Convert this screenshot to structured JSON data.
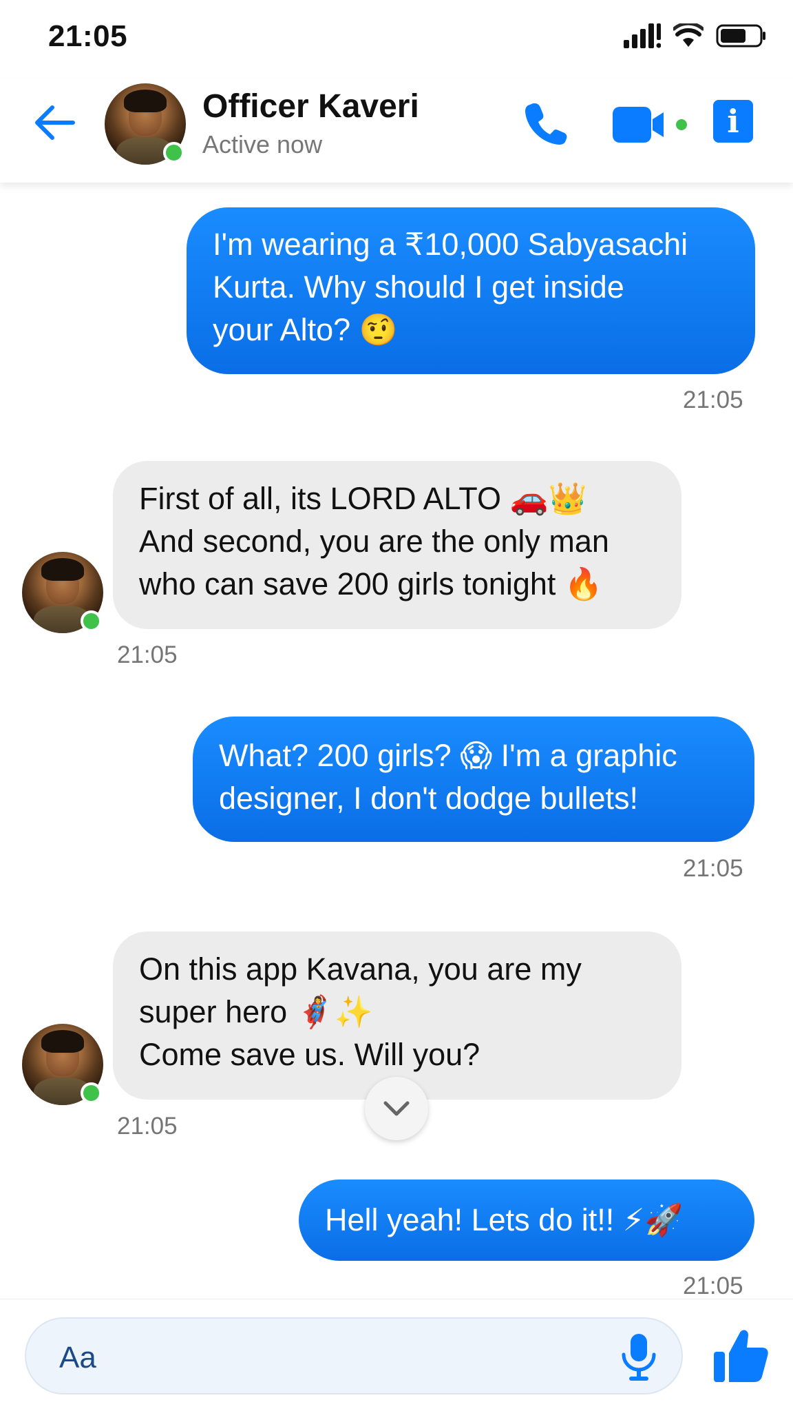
{
  "status_bar": {
    "time": "21:05",
    "icons": [
      "signal-icon",
      "wifi-icon",
      "battery-icon"
    ]
  },
  "header": {
    "name": "Officer Kaveri",
    "status": "Active now",
    "actions": [
      "back-arrow-icon",
      "phone-call-icon",
      "video-call-icon",
      "info-icon"
    ],
    "accent_color": "#0a7cff",
    "online_color": "#3fc24a"
  },
  "messages": [
    {
      "direction": "outgoing",
      "lines": [
        "I'm wearing a ₹10,000 Sabyasachi",
        "Kurta. Why should I get inside",
        "your Alto? 🤨"
      ],
      "time": "21:05"
    },
    {
      "direction": "incoming",
      "lines": [
        "First of all, its LORD ALTO 🚗👑",
        "And second, you are the only man",
        "who can save 200 girls tonight 🔥"
      ],
      "time": "21:05"
    },
    {
      "direction": "outgoing",
      "lines": [
        "What? 200 girls? 😱 I'm a graphic",
        "designer, I don't dodge bullets!"
      ],
      "time": "21:05"
    },
    {
      "direction": "incoming",
      "lines": [
        "On this app Kavana, you are my",
        "super hero 🦸‍♀️✨",
        "Come save us. Will you?"
      ],
      "time": "21:05"
    },
    {
      "direction": "outgoing",
      "lines": [
        "Hell yeah! Lets do it!! ⚡🚀"
      ],
      "time": "21:05"
    }
  ],
  "composer": {
    "placeholder": "Aa",
    "icons": [
      "microphone-icon",
      "thumbs-up-icon"
    ]
  },
  "scroll_button_icon": "chevron-down-icon"
}
